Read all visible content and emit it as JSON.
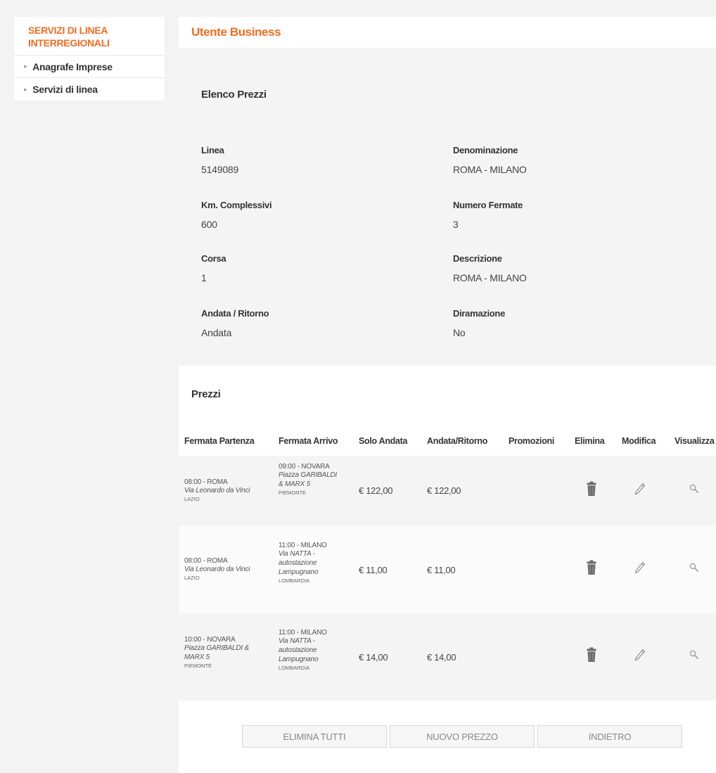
{
  "sidebar": {
    "title_line1": "SERVIZI DI LINEA",
    "title_line2": "INTERREGIONALI",
    "items": [
      {
        "label": "Anagrafe Imprese"
      },
      {
        "label": "Servizi di linea"
      }
    ]
  },
  "header": {
    "title": "Utente Business"
  },
  "info": {
    "section_title": "Elenco Prezzi",
    "linea_label": "Linea",
    "linea_value": "5149089",
    "denominazione_label": "Denominazione",
    "denominazione_value": "ROMA - MILANO",
    "km_label": "Km. Complessivi",
    "km_value": "600",
    "numero_fermate_label": "Numero Fermate",
    "numero_fermate_value": "3",
    "corsa_label": "Corsa",
    "corsa_value": "1",
    "descrizione_label": "Descrizione",
    "descrizione_value": "ROMA - MILANO",
    "andata_ritorno_label": "Andata / Ritorno",
    "andata_ritorno_value": "Andata",
    "diramazione_label": "Diramazione",
    "diramazione_value": "No"
  },
  "prezzi": {
    "title": "Prezzi",
    "columns": {
      "partenza": "Fermata Partenza",
      "arrivo": "Fermata Arrivo",
      "solo_andata": "Solo Andata",
      "andata_ritorno": "Andata/Ritorno",
      "promozioni": "Promozioni",
      "elimina": "Elimina",
      "modifica": "Modifica",
      "visualizza": "Visualizza"
    },
    "rows": [
      {
        "partenza_time": "08:00 - ROMA",
        "partenza_addr": [
          "Via Leonardo da Vinci"
        ],
        "partenza_region": "LAZIO",
        "arrivo_time": "09:00 - NOVARA",
        "arrivo_addr": [
          "Piazza GARIBALDI",
          "& MARX 5"
        ],
        "arrivo_region": "PIEMONTE",
        "solo_andata": "€ 122,00",
        "andata_ritorno": "€ 122,00",
        "promozioni": ""
      },
      {
        "partenza_time": "08:00 - ROMA",
        "partenza_addr": [
          "Via Leonardo da Vinci"
        ],
        "partenza_region": "LAZIO",
        "arrivo_time": "11:00 - MILANO",
        "arrivo_addr": [
          "Via NATTA -",
          "autostazione",
          "Lampugnano"
        ],
        "arrivo_region": "LOMBARDIA",
        "solo_andata": "€ 11,00",
        "andata_ritorno": "€ 11,00",
        "promozioni": ""
      },
      {
        "partenza_time": "10:00 - NOVARA",
        "partenza_addr": [
          "Piazza GARIBALDI &",
          "MARX 5"
        ],
        "partenza_region": "PIEMONTE",
        "arrivo_time": "11:00 - MILANO",
        "arrivo_addr": [
          "Via NATTA -",
          "autostazione",
          "Lampugnano"
        ],
        "arrivo_region": "LOMBARDIA",
        "solo_andata": "€ 14,00",
        "andata_ritorno": "€ 14,00",
        "promozioni": ""
      }
    ]
  },
  "buttons": {
    "elimina_tutti": "ELIMINA TUTTI",
    "nuovo_prezzo": "NUOVO PREZZO",
    "indietro": "INDIETRO"
  },
  "icons": {
    "delete": "trash-icon",
    "edit": "pencil-icon",
    "view": "magnifier-icon"
  },
  "colors": {
    "accent": "#f36c21"
  }
}
